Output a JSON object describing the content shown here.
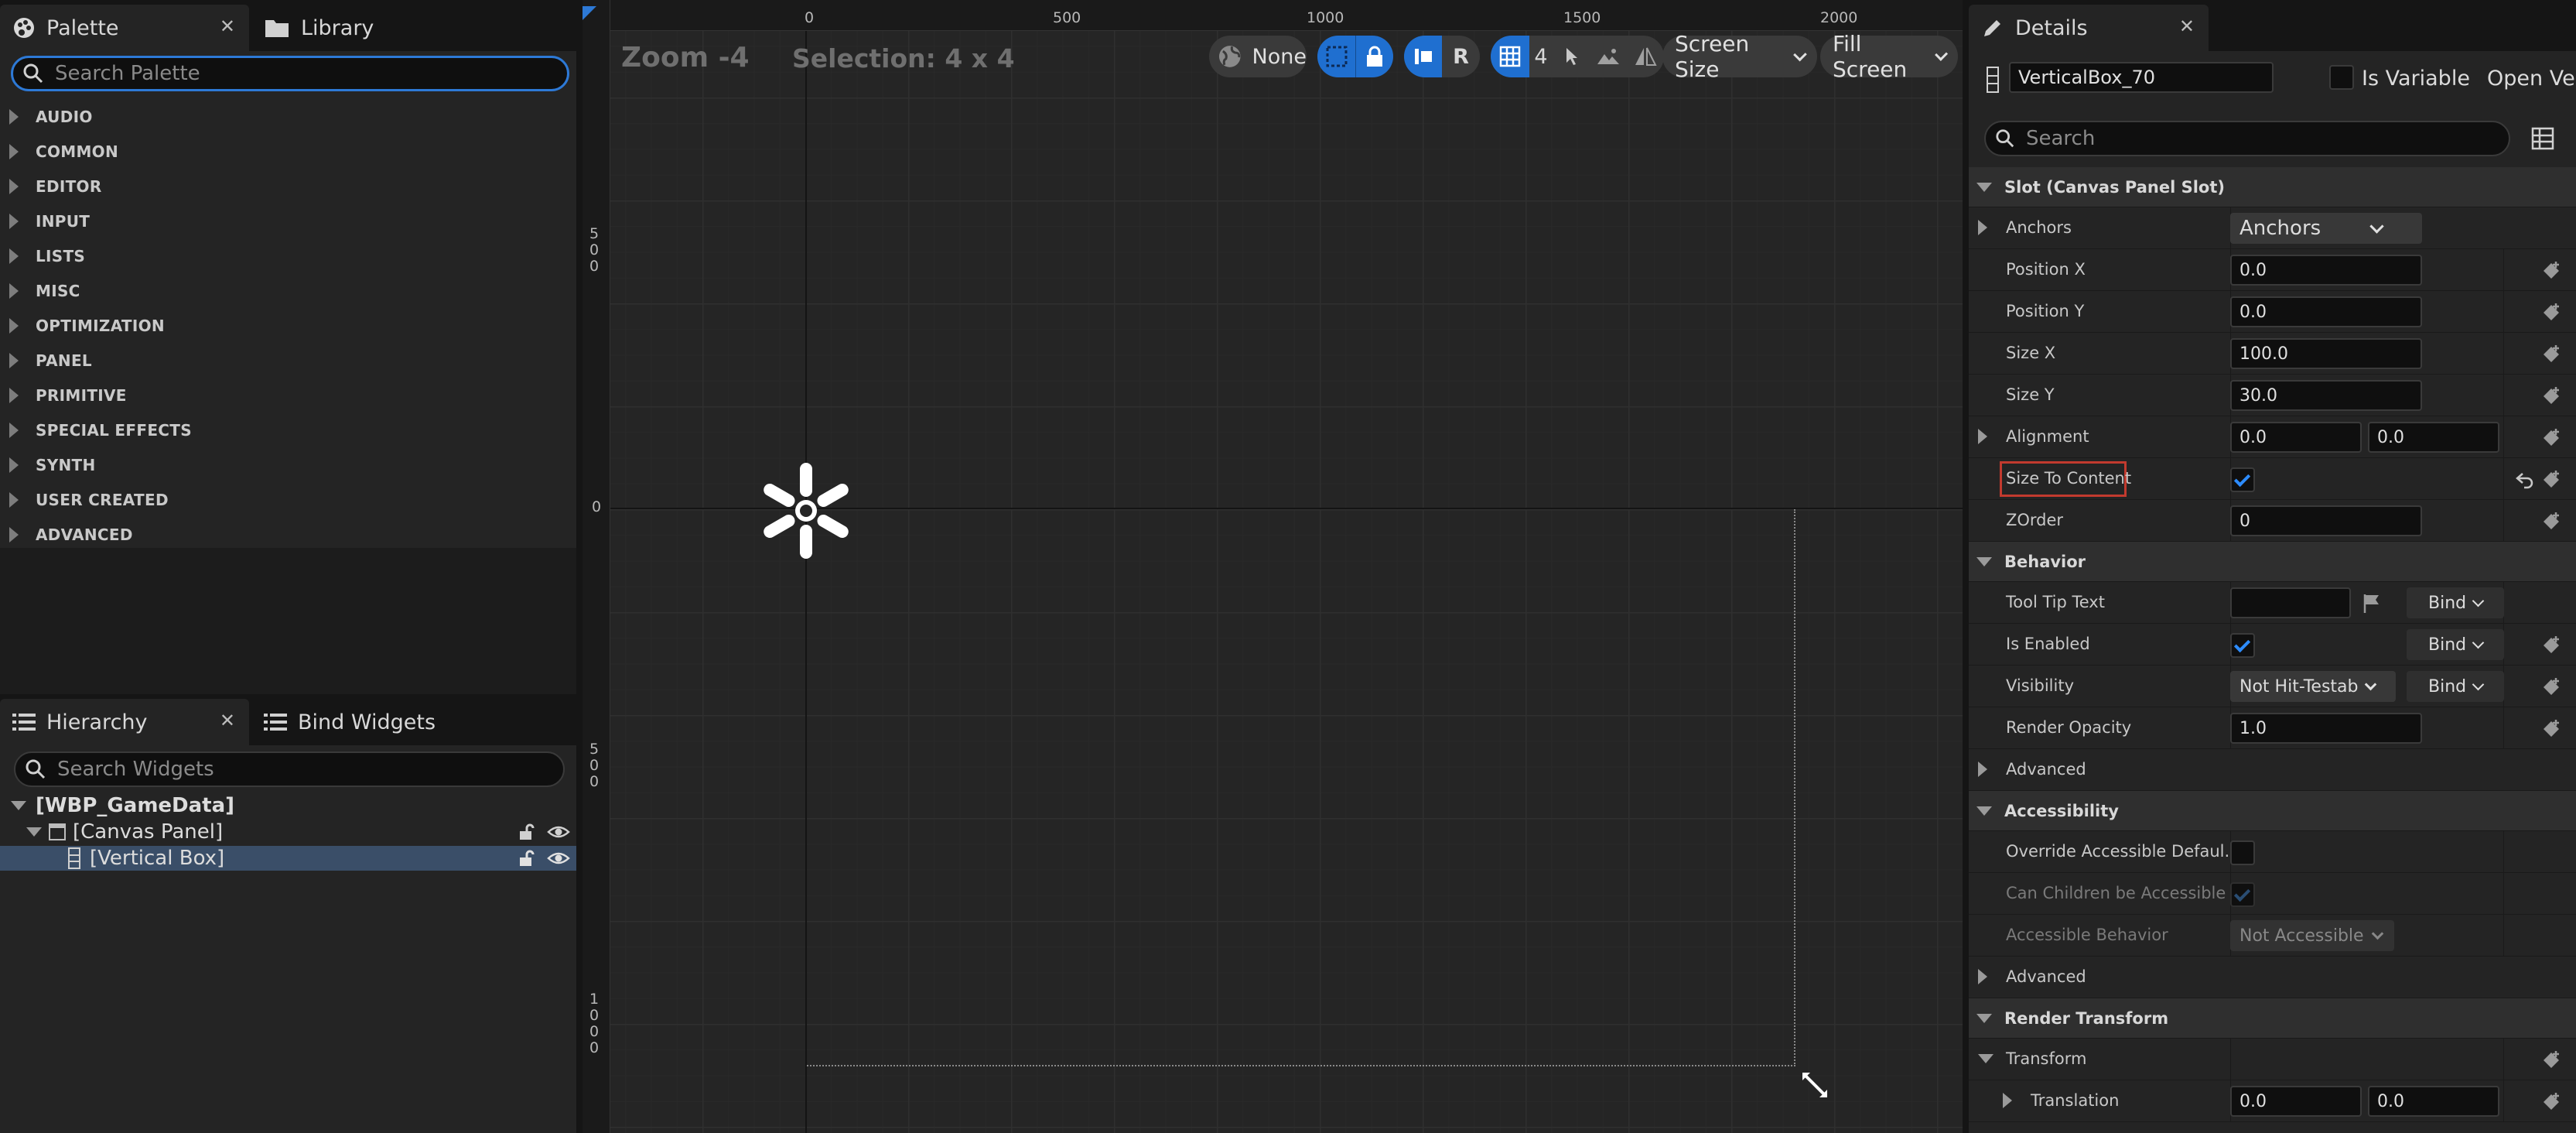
{
  "palette": {
    "tab_label": "Palette",
    "library_tab_label": "Library",
    "search_placeholder": "Search Palette",
    "categories": [
      "AUDIO",
      "COMMON",
      "EDITOR",
      "INPUT",
      "LISTS",
      "MISC",
      "OPTIMIZATION",
      "PANEL",
      "PRIMITIVE",
      "SPECIAL EFFECTS",
      "SYNTH",
      "USER CREATED",
      "ADVANCED"
    ]
  },
  "hierarchy": {
    "tab_label": "Hierarchy",
    "bind_tab_label": "Bind Widgets",
    "search_placeholder": "Search Widgets",
    "tree": [
      "[WBP_GameData]",
      "[Canvas Panel]",
      "[Vertical Box]"
    ]
  },
  "canvas": {
    "zoom": "Zoom -4",
    "selection": "Selection: 4 x 4",
    "ruler_top": [
      "0",
      "500",
      "1000",
      "1500",
      "2000"
    ],
    "ruler_left": [
      "500",
      "0",
      "500",
      "1000"
    ],
    "toolbar": {
      "localization": "None",
      "r_button": "R",
      "grid_snap": "4",
      "screen_size": "Screen Size",
      "fill_screen": "Fill Screen"
    }
  },
  "details": {
    "tab_label": "Details",
    "widget_name": "VerticalBox_70",
    "is_variable_label": "Is Variable",
    "open_label": "Open Vert",
    "search_placeholder": "Search",
    "slot_section": "Slot (Canvas Panel Slot)",
    "anchors_label": "Anchors",
    "anchors_value": "Anchors",
    "position_x_label": "Position X",
    "position_x": "0.0",
    "position_y_label": "Position Y",
    "position_y": "0.0",
    "size_x_label": "Size X",
    "size_x": "100.0",
    "size_y_label": "Size Y",
    "size_y": "30.0",
    "alignment_label": "Alignment",
    "alignment_x": "0.0",
    "alignment_y": "0.0",
    "size_to_content_label": "Size To Content",
    "zorder_label": "ZOrder",
    "zorder": "0",
    "behavior_section": "Behavior",
    "tooltip_label": "Tool Tip Text",
    "tooltip_value": "",
    "bind_label": "Bind",
    "is_enabled_label": "Is Enabled",
    "visibility_label": "Visibility",
    "visibility_value": "Not Hit-Testab",
    "render_opacity_label": "Render Opacity",
    "render_opacity": "1.0",
    "advanced_label": "Advanced",
    "accessibility_section": "Accessibility",
    "override_access_label": "Override Accessible Defaul...",
    "children_access_label": "Can Children be Accessible",
    "access_behavior_label": "Accessible Behavior",
    "access_behavior_value": "Not Accessible",
    "advanced2_label": "Advanced",
    "render_transform_section": "Render Transform",
    "transform_label": "Transform",
    "translation_label": "Translation",
    "translation_x": "0.0",
    "translation_y": "0.0"
  },
  "colors": {
    "accent": "#2d79d6",
    "selected_row": "#3a4e68",
    "highlight": "#c23a2e"
  }
}
